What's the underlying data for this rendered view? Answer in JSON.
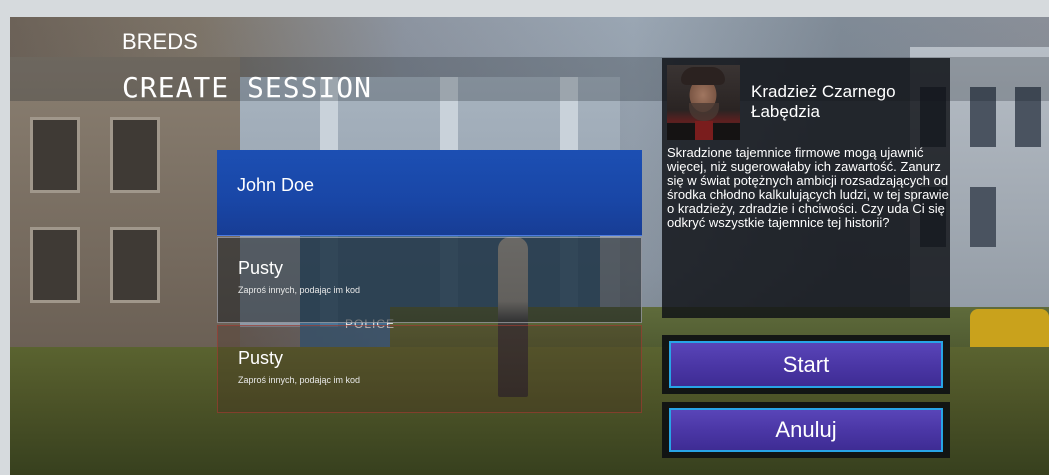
{
  "header": {
    "brand": "BREDS",
    "title": "CREATE SESSION"
  },
  "slots": [
    {
      "name": "John Doe",
      "subtitle": ""
    },
    {
      "name": "Pusty",
      "subtitle": "Zaproś innych, podając im kod"
    },
    {
      "name": "Pusty",
      "subtitle": "Zaproś innych, podając im kod"
    }
  ],
  "story": {
    "title": "Kradzież Czarnego Łabędzia",
    "description": "Skradzione tajemnice firmowe mogą ujawnić więcej, niż sugerowałaby ich zawartość. Zanurz się w świat potężnych ambicji rozsadzających od środka chłodno kalkulujących ludzi, w tej sprawie o kradzieży, zdradzie i chciwości. Czy uda Ci się odkryć wszystkie tajemnice tej historii?"
  },
  "buttons": {
    "start": "Start",
    "cancel": "Anuluj"
  },
  "scene": {
    "sign_text": "POLICE"
  },
  "colors": {
    "selected_slot": "#1c4fb3",
    "button_fill": "#4b37a6",
    "button_border": "#28a4e6"
  }
}
